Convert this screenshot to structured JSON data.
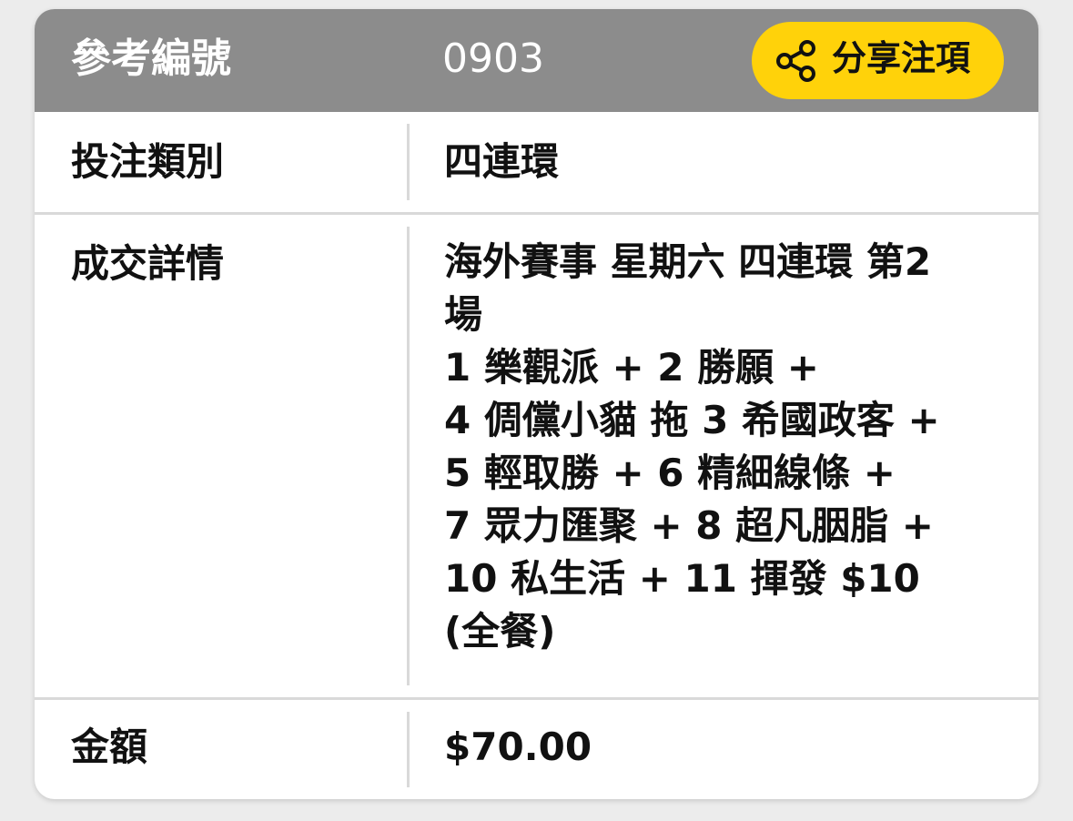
{
  "header": {
    "label": "參考編號",
    "value": "0903",
    "share_label": "分享注項",
    "share_icon": "share-icon",
    "background": "#8c8c8c",
    "button_color": "#ffd20a"
  },
  "rows": [
    {
      "label": "投注類別",
      "value": "四連環"
    },
    {
      "label": "成交詳情",
      "lines": [
        "海外賽事 星期六 四連環 第2",
        "場",
        "1 樂觀派 + 2 勝願 +",
        "4 倜儻小貓 拖 3 希國政客 +",
        "5 輕取勝 + 6 精細線條 +",
        "7 眾力匯聚 + 8 超凡胭脂 +",
        "10 私生活 + 11 揮發 $10",
        "(全餐)"
      ]
    },
    {
      "label": "金額",
      "value": "$70.00"
    }
  ]
}
